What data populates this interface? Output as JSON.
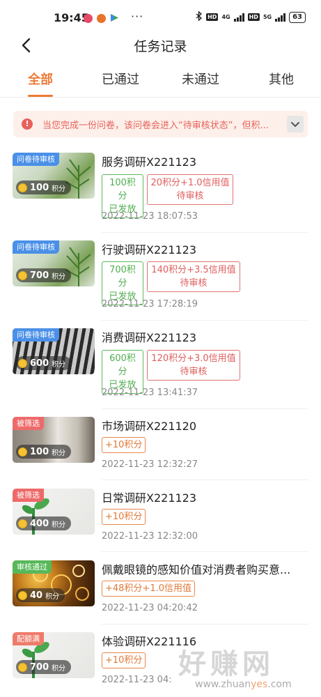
{
  "status_bar": {
    "time": "19:45",
    "more": "···",
    "hd1": "HD",
    "net1": "4G",
    "hd2": "HD",
    "net2": "5G",
    "battery": "63"
  },
  "header": {
    "title": "任务记录",
    "back_icon": "chevron-left-icon"
  },
  "tabs": [
    {
      "label": "全部",
      "active": true
    },
    {
      "label": "已通过",
      "active": false
    },
    {
      "label": "未通过",
      "active": false
    },
    {
      "label": "其他",
      "active": false
    }
  ],
  "notice": {
    "icon": "!",
    "text": "当您完成一份问卷，该问卷会进入“待审核状态”，但积..."
  },
  "tasks": [
    {
      "tag": "问卷待审核",
      "points": "100",
      "points_unit": "积分",
      "title": "服务调研X221123",
      "box1": [
        "100积分",
        "已发放"
      ],
      "box2": [
        "20积分+1.0信用值",
        "待审核"
      ],
      "time": "2022-11-23 18:07:53"
    },
    {
      "tag": "问卷待审核",
      "points": "700",
      "points_unit": "积分",
      "title": "行驶调研X221123",
      "box1": [
        "700积分",
        "已发放"
      ],
      "box2": [
        "140积分+3.5信用值",
        "待审核"
      ],
      "time": "2022-11-23 17:28:19"
    },
    {
      "tag": "问卷待审核",
      "points": "600",
      "points_unit": "积分",
      "title": "消费调研X221123",
      "box1": [
        "600积分",
        "已发放"
      ],
      "box2": [
        "120积分+3.0信用值",
        "待审核"
      ],
      "time": "2022-11-23 13:41:37"
    },
    {
      "tag": "被筛选",
      "points": "100",
      "points_unit": "积分",
      "title": "市场调研X221120",
      "reward": "+10积分",
      "time": "2022-11-23 12:32:27"
    },
    {
      "tag": "被筛选",
      "points": "400",
      "points_unit": "积分",
      "title": "日常调研X221123",
      "reward": "+10积分",
      "time": "2022-11-23 12:32:00"
    },
    {
      "tag": "审核通过",
      "points": "40",
      "points_unit": "积分",
      "title": "佩戴眼镜的感知价值对消费者购买意...",
      "reward": "+48积分+1.0信用值",
      "time": "2022-11-23 04:20:42"
    },
    {
      "tag": "配额满",
      "points": "700",
      "points_unit": "积分",
      "title": "体验调研X221116",
      "reward": "+10积分",
      "time": "2022-11-23 04:"
    }
  ],
  "watermark": {
    "big": "好赚网",
    "small_a": "www.zhuan",
    "small_b": "yes",
    "small_c": ".com"
  }
}
